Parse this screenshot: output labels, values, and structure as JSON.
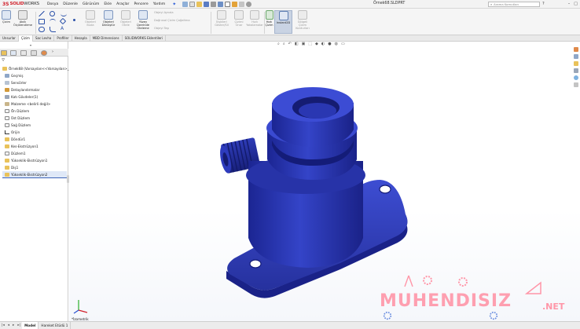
{
  "app": {
    "logo_mark": "3S",
    "logo_text": "SOLID",
    "logo_text_thin": "WORKS",
    "document_title": "Örnek68.SLDPRT",
    "search_placeholder": "Arama Komutları"
  },
  "menu": [
    "Dosya",
    "Düzenle",
    "Görünüm",
    "Ekle",
    "Araçlar",
    "Pencere",
    "Yardım"
  ],
  "ribbon": {
    "buttons": [
      {
        "label": "Çizim",
        "dim": false
      },
      {
        "label": "Akıllı Ölçülendirme",
        "dim": false
      },
      {
        "label": "Objeleri Buda",
        "dim": true
      },
      {
        "label": "Objeleri Dönüştür",
        "dim": false
      },
      {
        "label": "Objeleri Ötele",
        "dim": true
      },
      {
        "label": "Yüzey Üzerinde Öteleme",
        "dim": false
      },
      {
        "label": "Objeyi Aynala",
        "dim": true
      },
      {
        "label": "Doğrusal Çizim Çoğaltma",
        "dim": true
      },
      {
        "label": "Objeyi Taşı",
        "dim": true
      },
      {
        "label": "İlişkileri Göster/Sil",
        "dim": true
      },
      {
        "label": "Çizimi Onar",
        "dim": true
      },
      {
        "label": "Hızlı Yakalamalar",
        "dim": true
      },
      {
        "label": "Hızlı Çizim",
        "dim": false
      },
      {
        "label": "Instant2D",
        "dim": false
      },
      {
        "label": "Gölgeli Çizim Konturları",
        "dim": true
      }
    ]
  },
  "tabs": [
    "Unsurlar",
    "Çizim",
    "Sac Levha",
    "Profiller",
    "Hesapla",
    "MBD Dimensions",
    "SOLIDWORKS Eklentileri"
  ],
  "feature_tree": {
    "root": "Örnek68  (Varsayılan<<Varsayılan>_Gö",
    "items": [
      "Geçmiş",
      "Sensörler",
      "Detaylandırmalar",
      "Katı Gövdeler(1)",
      "Malzeme <belirli değil>",
      "Ön Düzlem",
      "Üst Düzlem",
      "Sağ Düzlem",
      "Orijin",
      "Döndür1",
      "Kes-Ekstrüzyon1",
      "Düzlem1",
      "Yükseklik-Ekstrüzyon1",
      "Diş1",
      "Yükseklik-Ekstrüzyon2"
    ]
  },
  "viewport": {
    "view_label": "*İzometrik"
  },
  "watermark": {
    "text": "MUHENDISIZ",
    "suffix": ".NET"
  },
  "bottom_tabs": [
    "Model",
    "Hareket Etüdü 1"
  ],
  "colors": {
    "part_blue": "#2b39b5",
    "part_highlight": "#4554d8",
    "part_shadow": "#141c78",
    "accent_red": "#d0202a",
    "watermark": "#ff96a8"
  }
}
